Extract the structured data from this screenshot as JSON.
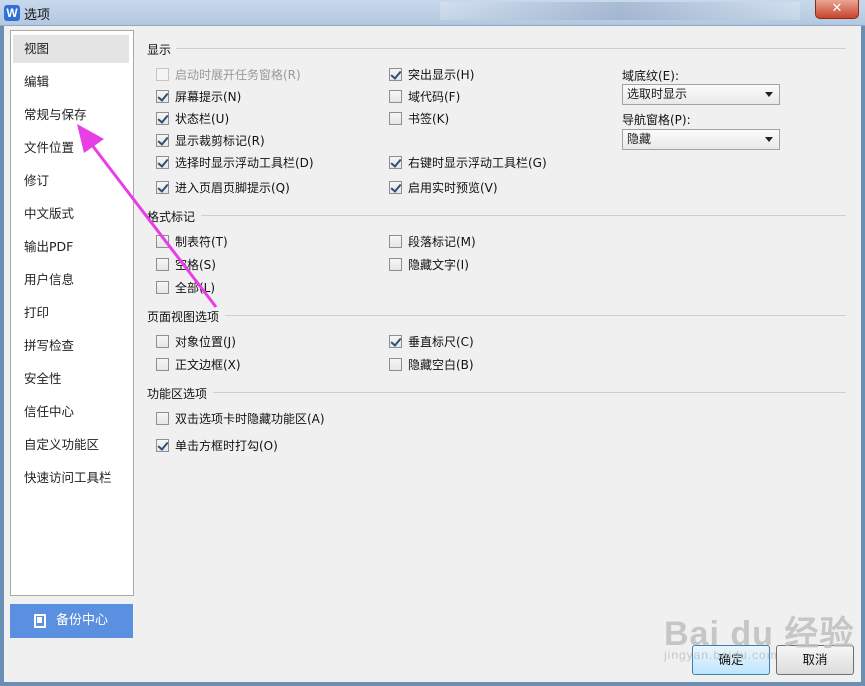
{
  "window": {
    "title": "选项",
    "close_label": "✕"
  },
  "sidebar": {
    "items": [
      {
        "label": "视图",
        "selected": true
      },
      {
        "label": "编辑"
      },
      {
        "label": "常规与保存"
      },
      {
        "label": "文件位置"
      },
      {
        "label": "修订"
      },
      {
        "label": "中文版式"
      },
      {
        "label": "输出PDF"
      },
      {
        "label": "用户信息"
      },
      {
        "label": "打印"
      },
      {
        "label": "拼写检查"
      },
      {
        "label": "安全性"
      },
      {
        "label": "信任中心"
      },
      {
        "label": "自定义功能区"
      },
      {
        "label": "快速访问工具栏"
      }
    ],
    "backup_label": "备份中心"
  },
  "display": {
    "title": "显示",
    "startup_task_pane": {
      "label": "启动时展开任务窗格(R)",
      "checked": false,
      "disabled": true
    },
    "screen_tips": {
      "label": "屏幕提示(N)",
      "checked": true
    },
    "status_bar": {
      "label": "状态栏(U)",
      "checked": true
    },
    "crop_marks": {
      "label": "显示裁剪标记(R)",
      "checked": true
    },
    "float_toolbar_select": {
      "label": "选择时显示浮动工具栏(D)",
      "checked": true
    },
    "header_footer_hint": {
      "label": "进入页眉页脚提示(Q)",
      "checked": true
    },
    "highlight": {
      "label": "突出显示(H)",
      "checked": true
    },
    "field_codes": {
      "label": "域代码(F)",
      "checked": false
    },
    "bookmarks": {
      "label": "书签(K)",
      "checked": false
    },
    "float_toolbar_rightclick": {
      "label": "右键时显示浮动工具栏(G)",
      "checked": true
    },
    "live_preview": {
      "label": "启用实时预览(V)",
      "checked": true
    },
    "field_shading_label": "域底纹(E):",
    "field_shading_value": "选取时显示",
    "nav_pane_label": "导航窗格(P):",
    "nav_pane_value": "隐藏"
  },
  "format_marks": {
    "title": "格式标记",
    "tabs": {
      "label": "制表符(T)",
      "checked": false
    },
    "spaces": {
      "label": "空格(S)",
      "checked": false
    },
    "all": {
      "label": "全部(L)",
      "checked": false
    },
    "paragraph": {
      "label": "段落标记(M)",
      "checked": false
    },
    "hidden_text": {
      "label": "隐藏文字(I)",
      "checked": false
    }
  },
  "page_view": {
    "title": "页面视图选项",
    "object_anchors": {
      "label": "对象位置(J)",
      "checked": false
    },
    "text_boundaries": {
      "label": "正文边框(X)",
      "checked": false
    },
    "vertical_ruler": {
      "label": "垂直标尺(C)",
      "checked": true
    },
    "hide_white_space": {
      "label": "隐藏空白(B)",
      "checked": false
    }
  },
  "ribbon": {
    "title": "功能区选项",
    "dblclick_hide": {
      "label": "双击选项卡时隐藏功能区(A)",
      "checked": false
    },
    "click_checkbox": {
      "label": "单击方框时打勾(O)",
      "checked": true
    }
  },
  "buttons": {
    "ok": "确定",
    "cancel": "取消"
  },
  "watermark": {
    "main": "Bai du 经验",
    "sub": "jingyan.baidu.com"
  },
  "colors": {
    "accent": "#5b90e0",
    "annotation": "#e83ee6"
  }
}
